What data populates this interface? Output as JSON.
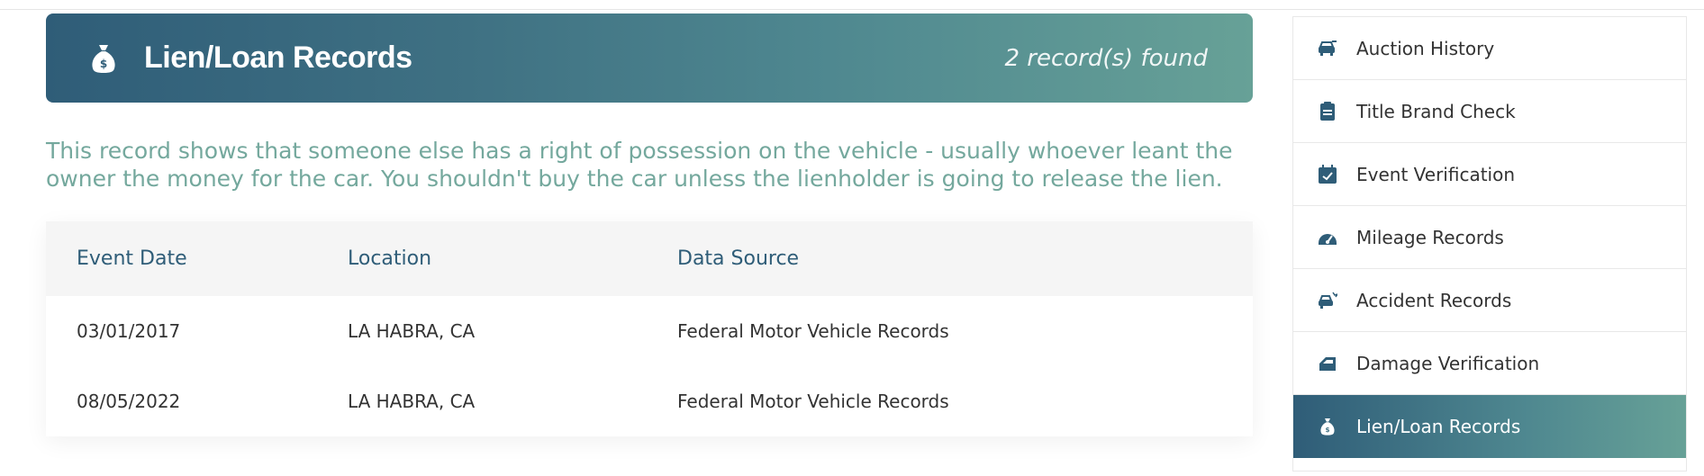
{
  "header": {
    "icon": "money-bag-icon",
    "title": "Lien/Loan Records",
    "record_count": "2 record(s) found"
  },
  "description": "This record shows that someone else has a right of possession on the vehicle - usually whoever leant the owner the money for the car. You shouldn't buy the car unless the lienholder is going to release the lien.",
  "table": {
    "columns": [
      "Event Date",
      "Location",
      "Data Source"
    ],
    "rows": [
      [
        "03/01/2017",
        "LA HABRA, CA",
        "Federal Motor Vehicle Records"
      ],
      [
        "08/05/2022",
        "LA HABRA, CA",
        "Federal Motor Vehicle Records"
      ]
    ]
  },
  "sidebar": {
    "items": [
      {
        "label": "Auction History",
        "icon": "car-auction-icon"
      },
      {
        "label": "Title Brand Check",
        "icon": "document-icon"
      },
      {
        "label": "Event Verification",
        "icon": "calendar-check-icon"
      },
      {
        "label": "Mileage Records",
        "icon": "speedometer-icon"
      },
      {
        "label": "Accident Records",
        "icon": "car-crash-icon"
      },
      {
        "label": "Damage Verification",
        "icon": "car-door-icon"
      },
      {
        "label": "Lien/Loan Records",
        "icon": "money-bag-icon",
        "active": true
      }
    ]
  },
  "colors": {
    "primary": "#2f5d78",
    "accent": "#67a197",
    "description_text": "#74a89d"
  }
}
